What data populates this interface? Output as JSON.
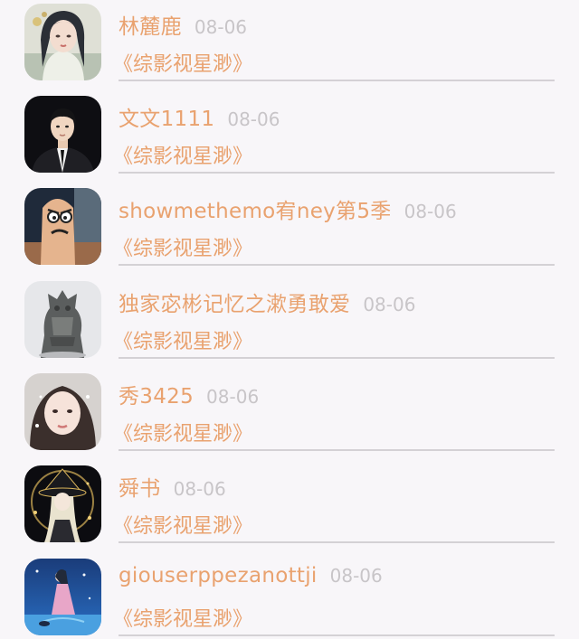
{
  "comments": [
    {
      "name": "林麓鹿",
      "date": "08-06",
      "book": "《综影视星渺》",
      "avatar": "avatar-woman-hanfu"
    },
    {
      "name": "文文1111",
      "date": "08-06",
      "book": "《综影视星渺》",
      "avatar": "avatar-man-suit"
    },
    {
      "name": "showmethemo宥ney第5季",
      "date": "08-06",
      "book": "《综影视星渺》",
      "avatar": "avatar-finger-face"
    },
    {
      "name": "独家宓彬记忆之漱勇敢爱",
      "date": "08-06",
      "book": "《综影视星渺》",
      "avatar": "avatar-bronze-statue"
    },
    {
      "name": "秀3425",
      "date": "08-06",
      "book": "《综影视星渺》",
      "avatar": "avatar-girl-selfie"
    },
    {
      "name": "舜书",
      "date": "08-06",
      "book": "《综影视星渺》",
      "avatar": "avatar-anime-witch"
    },
    {
      "name": "giouserppezanottji",
      "date": "08-06",
      "book": "《综影视星渺》",
      "avatar": "avatar-blue-ocean"
    }
  ],
  "colors": {
    "name": "#e9a26f",
    "date": "#c8c5c8",
    "divider": "#d4d1d5",
    "background": "#f8f6f9"
  }
}
